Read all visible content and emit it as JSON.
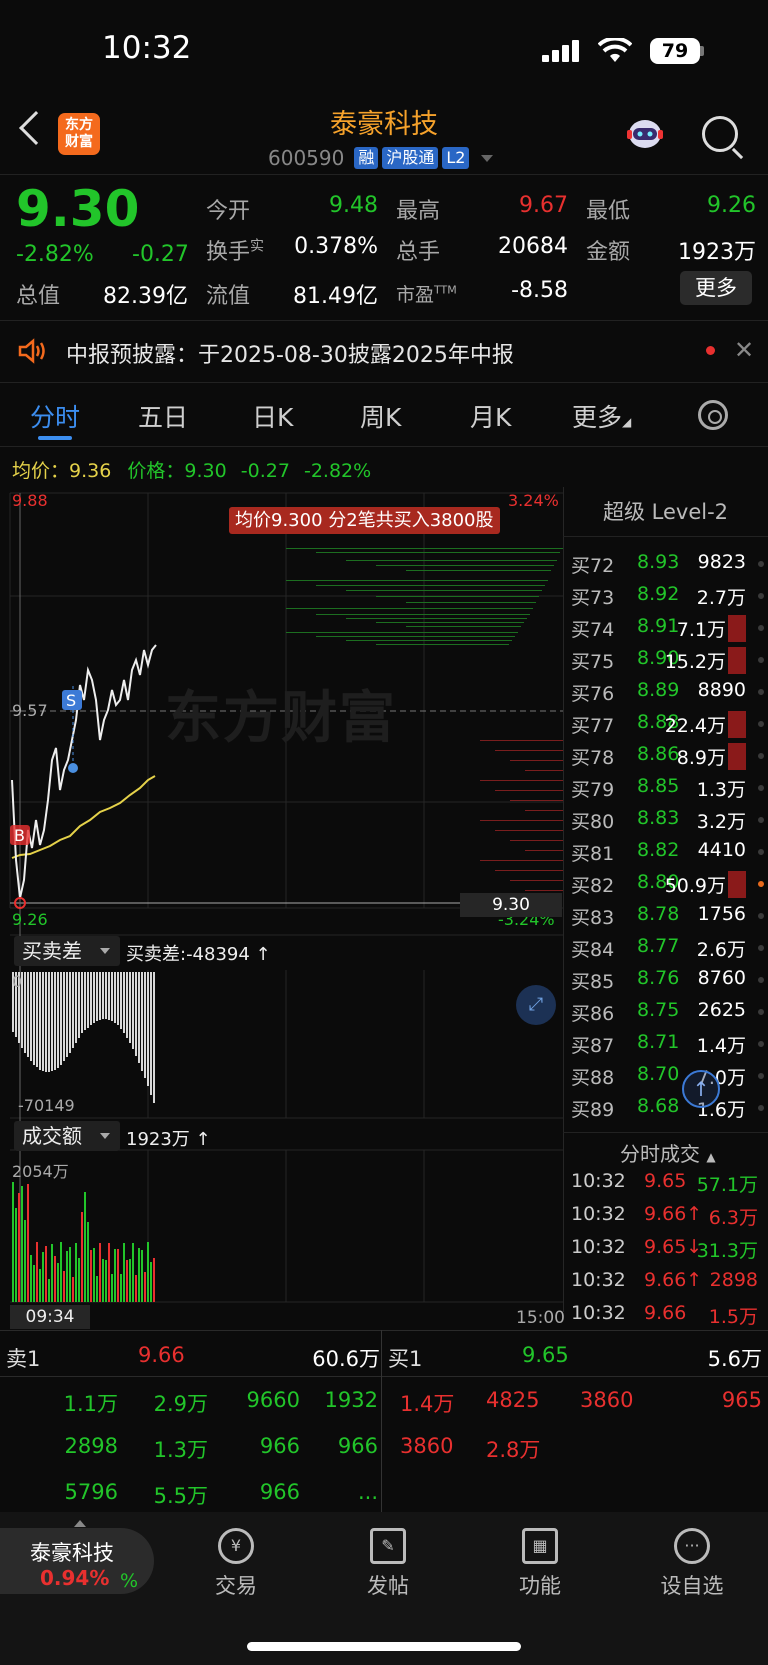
{
  "status_bar": {
    "time": "10:32",
    "battery": "79"
  },
  "header": {
    "logo_text_1": "东方",
    "logo_text_2": "财富",
    "stock_name": "泰豪科技",
    "stock_code": "600590",
    "tags": [
      "融",
      "沪股通",
      "L2"
    ]
  },
  "quote": {
    "price": "9.30",
    "change_pct": "-2.82%",
    "change": "-0.27",
    "total_value_label": "总值",
    "total_value": "82.39亿",
    "open_label": "今开",
    "open": "9.48",
    "turnover_label": "换手",
    "turnover_sup": "实",
    "turnover": "0.378%",
    "float_value_label": "流值",
    "float_value": "81.49亿",
    "high_label": "最高",
    "high": "9.67",
    "volume_label": "总手",
    "volume": "20684",
    "pe_label": "市盈",
    "pe_sup": "TTM",
    "pe": "-8.58",
    "low_label": "最低",
    "low": "9.26",
    "amount_label": "金额",
    "amount": "1923万",
    "more_label": "更多"
  },
  "notice": {
    "text": "中报预披露：于2025-08-30披露2025年中报"
  },
  "tabs": [
    "分时",
    "五日",
    "日K",
    "周K",
    "月K",
    "更多"
  ],
  "avg_row": {
    "avg_label": "均价：",
    "avg_value": "9.36",
    "price_label": "价格：",
    "price_value": "9.30",
    "change": "-0.27",
    "change_pct": "-2.82%"
  },
  "chart_labels": {
    "top": "9.88",
    "mid": "9.57",
    "bottom": "9.26",
    "top_right": "3.24%",
    "bottom_right": "-3.24%",
    "price_line": "9.30",
    "trade_banner": "均价9.300  分2笔共买入3800股",
    "watermark": "东方财富",
    "buy_marker": "B",
    "sell_marker": "S"
  },
  "level2": {
    "title": "超级 Level-2",
    "rows": [
      {
        "label": "买72",
        "price": "8.93",
        "vol": "9823"
      },
      {
        "label": "买73",
        "price": "8.92",
        "vol": "2.7万"
      },
      {
        "label": "买74",
        "price": "8.91",
        "vol": "7.1万"
      },
      {
        "label": "买75",
        "price": "8.90",
        "vol": "15.2万"
      },
      {
        "label": "买76",
        "price": "8.89",
        "vol": "8890"
      },
      {
        "label": "买77",
        "price": "8.88",
        "vol": "22.4万"
      },
      {
        "label": "买78",
        "price": "8.86",
        "vol": "8.9万"
      },
      {
        "label": "买79",
        "price": "8.85",
        "vol": "1.3万"
      },
      {
        "label": "买80",
        "price": "8.83",
        "vol": "3.2万"
      },
      {
        "label": "买81",
        "price": "8.82",
        "vol": "4410"
      },
      {
        "label": "买82",
        "price": "8.80",
        "vol": "50.9万"
      },
      {
        "label": "买83",
        "price": "8.78",
        "vol": "1756"
      },
      {
        "label": "买84",
        "price": "8.77",
        "vol": "2.6万"
      },
      {
        "label": "买85",
        "price": "8.76",
        "vol": "8760"
      },
      {
        "label": "买86",
        "price": "8.75",
        "vol": "2625"
      },
      {
        "label": "买87",
        "price": "8.71",
        "vol": "1.4万"
      },
      {
        "label": "买88",
        "price": "8.70",
        "vol": "7.0万"
      },
      {
        "label": "买89",
        "price": "8.68",
        "vol": "1.6万"
      }
    ],
    "ticks_title": "分时成交",
    "ticks": [
      {
        "time": "10:32",
        "price": "9.65",
        "vol": "57.1万"
      },
      {
        "time": "10:32",
        "price": "9.66↑",
        "vol": "6.3万"
      },
      {
        "time": "10:32",
        "price": "9.65↓",
        "vol": "31.3万"
      },
      {
        "time": "10:32",
        "price": "9.66↑",
        "vol": "2898"
      },
      {
        "time": "10:32",
        "price": "9.66",
        "vol": "1.5万"
      }
    ]
  },
  "sub1": {
    "selector": "买卖差",
    "value": "买卖差:-48394 ↑",
    "top_label": "0",
    "bottom_label": "-70149"
  },
  "sub2": {
    "selector": "成交额",
    "value": "1923万 ↑",
    "top_label": "2054万",
    "time_start": "09:34",
    "time_end": "15:00"
  },
  "orderbook": {
    "sell_label": "卖1",
    "sell_price": "9.66",
    "sell_total": "60.6万",
    "buy_label": "买1",
    "buy_price": "9.65",
    "buy_total": "5.6万",
    "sell_orders": [
      "1.1万",
      "2.9万",
      "9660",
      "1932",
      "2898",
      "1.3万",
      "966",
      "966",
      "5796",
      "5.5万",
      "966",
      "..."
    ],
    "buy_orders": [
      "1.4万",
      "4825",
      "3860",
      "965",
      "3860",
      "2.8万"
    ]
  },
  "float_card": {
    "name": "泰豪科技",
    "pct": "0.94%",
    "ghost": "%"
  },
  "nav": [
    {
      "label": "交易",
      "icon": "¥"
    },
    {
      "label": "发帖",
      "icon": "✎"
    },
    {
      "label": "功能",
      "icon": "▦"
    },
    {
      "label": "设自选",
      "icon": "···"
    }
  ]
}
